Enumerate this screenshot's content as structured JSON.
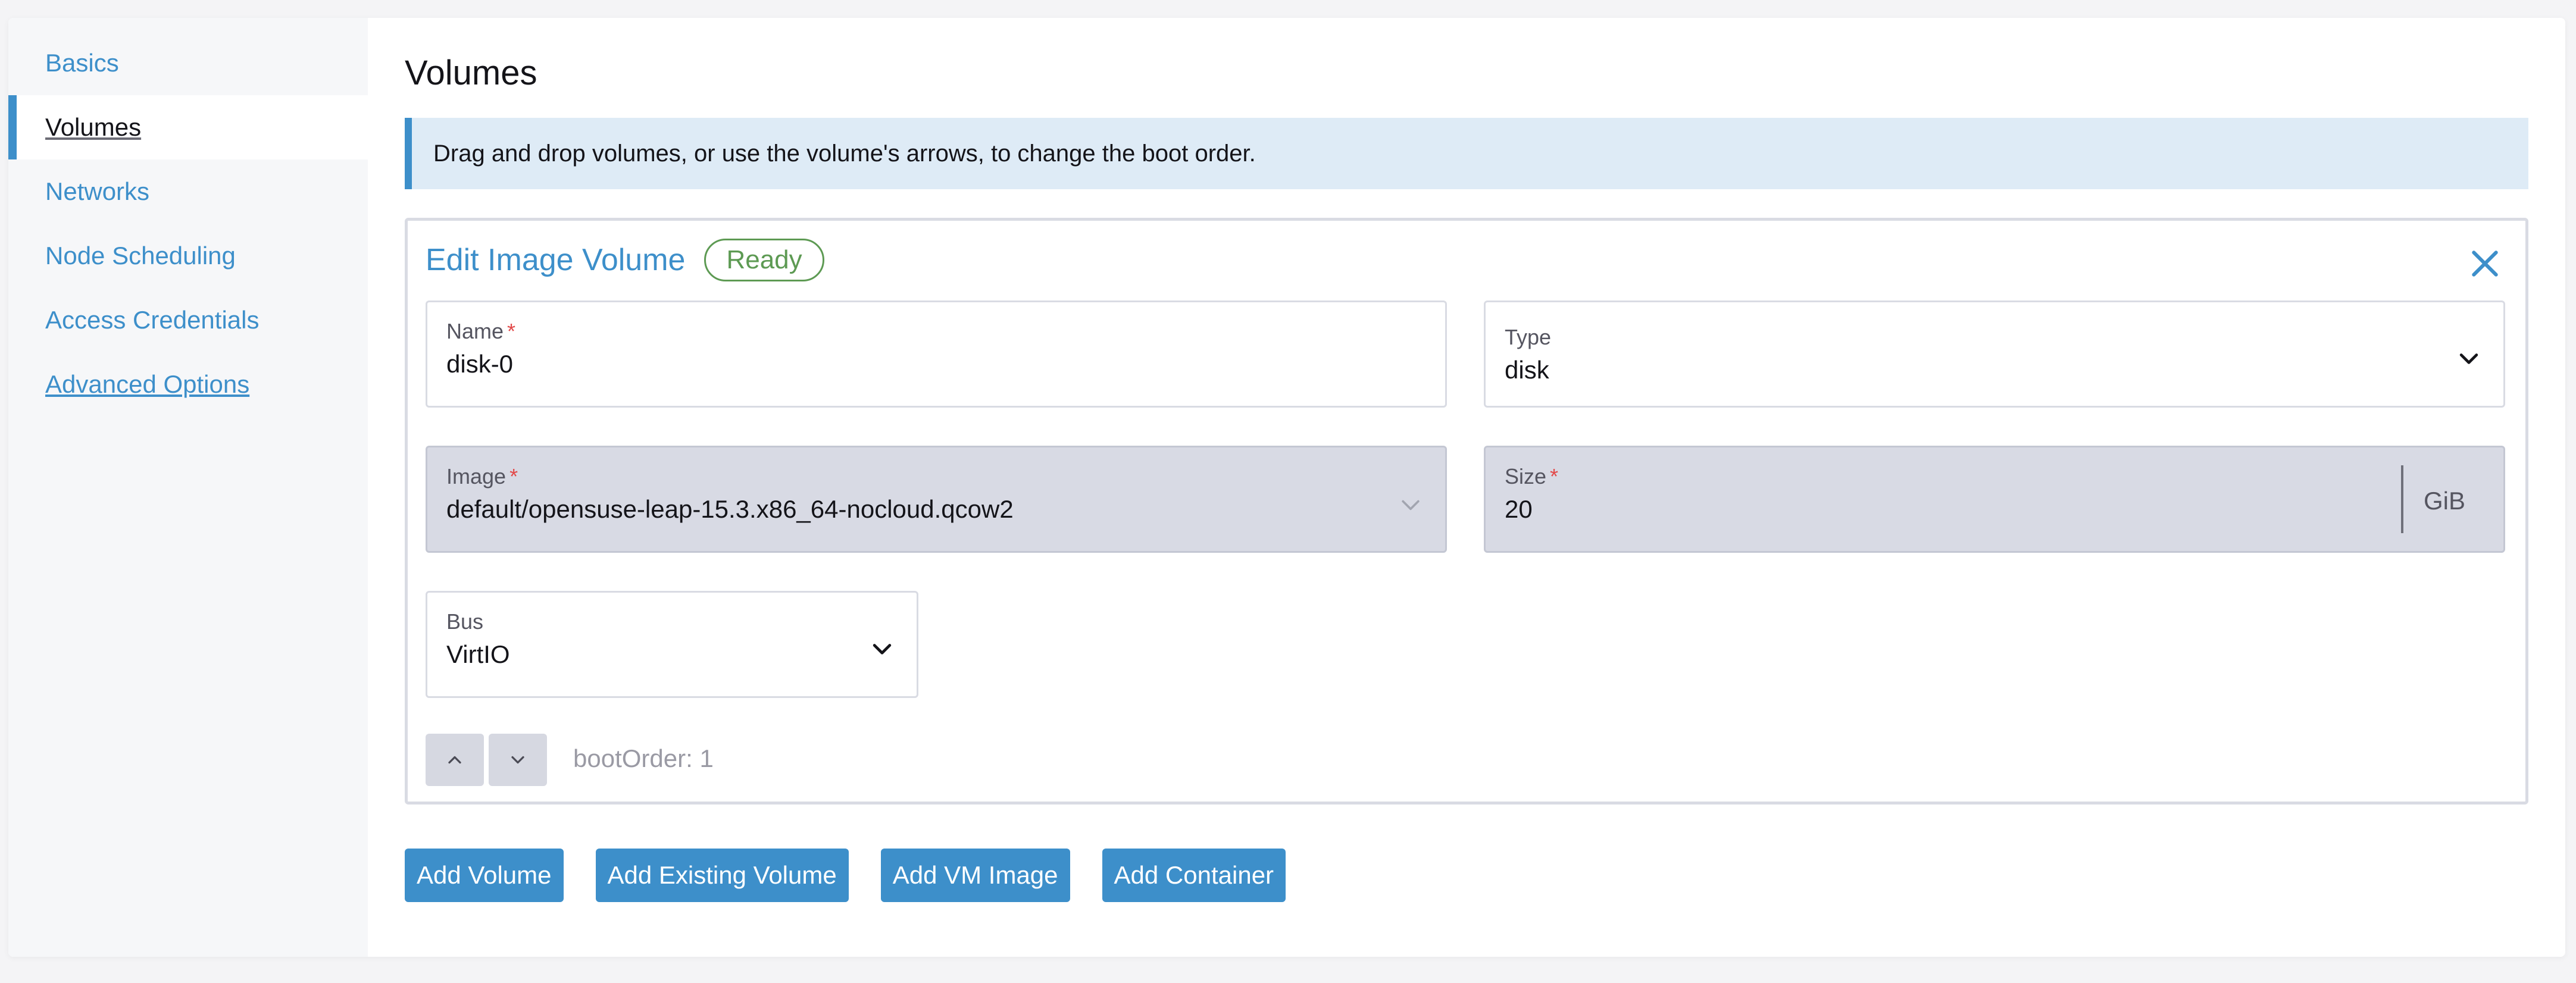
{
  "sidebar": {
    "items": [
      {
        "label": "Basics"
      },
      {
        "label": "Volumes"
      },
      {
        "label": "Networks"
      },
      {
        "label": "Node Scheduling"
      },
      {
        "label": "Access Credentials"
      },
      {
        "label": "Advanced Options"
      }
    ]
  },
  "main": {
    "title": "Volumes",
    "banner": "Drag and drop volumes, or use the volume's arrows, to change the boot order.",
    "card": {
      "title": "Edit Image Volume",
      "status": "Ready",
      "fields": {
        "name": {
          "label": "Name",
          "value": "disk-0"
        },
        "type": {
          "label": "Type",
          "value": "disk"
        },
        "image": {
          "label": "Image",
          "value": "default/opensuse-leap-15.3.x86_64-nocloud.qcow2"
        },
        "size": {
          "label": "Size",
          "value": "20",
          "unit": "GiB"
        },
        "bus": {
          "label": "Bus",
          "value": "VirtIO"
        }
      },
      "boot_order": "bootOrder: 1"
    },
    "actions": {
      "add_volume": "Add Volume",
      "add_existing_volume": "Add Existing Volume",
      "add_vm_image": "Add VM Image",
      "add_container": "Add Container"
    }
  },
  "required_marker": "*",
  "colors": {
    "accent": "#3d8fca",
    "ready": "#5d9a53",
    "required": "#e24a4a",
    "banner_bg": "#deebf6"
  }
}
